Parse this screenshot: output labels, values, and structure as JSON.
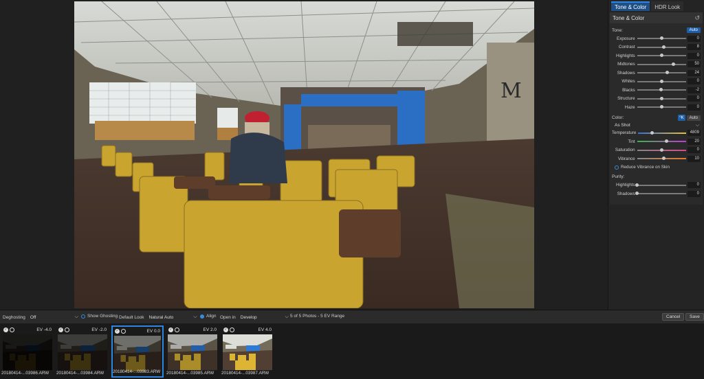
{
  "tabs": [
    {
      "label": "Tone & Color",
      "active": true
    },
    {
      "label": "HDR Look",
      "active": false
    }
  ],
  "panel": {
    "section_title": "Tone & Color",
    "tone_label": "Tone:",
    "tone_auto": "Auto",
    "tone_sliders": [
      {
        "label": "Exposure",
        "value": "0",
        "pos": 0.5
      },
      {
        "label": "Contrast",
        "value": "8",
        "pos": 0.54
      },
      {
        "label": "Highlights",
        "value": "0",
        "pos": 0.5
      },
      {
        "label": "Midtones",
        "value": "50",
        "pos": 0.75
      },
      {
        "label": "Shadows",
        "value": "24",
        "pos": 0.62
      },
      {
        "label": "Whites",
        "value": "0",
        "pos": 0.5
      },
      {
        "label": "Blacks",
        "value": "-2",
        "pos": 0.49
      },
      {
        "label": "Structure",
        "value": "0",
        "pos": 0.5
      },
      {
        "label": "Haze",
        "value": "0",
        "pos": 0.5
      }
    ],
    "color_label": "Color:",
    "color_auto": "Auto",
    "wb_preset": "As Shot",
    "color_sliders": [
      {
        "label": "Temperature",
        "value": "4809",
        "pos": 0.3,
        "grad": "linear-gradient(90deg,#3a6fd8,#e8c23a)"
      },
      {
        "label": "Tint",
        "value": "20",
        "pos": 0.6,
        "grad": "linear-gradient(90deg,#3cb44a,#c23ad8)"
      },
      {
        "label": "Saturation",
        "value": "0",
        "pos": 0.5,
        "grad": "linear-gradient(90deg,#888,#d84a8f)"
      },
      {
        "label": "Vibrance",
        "value": "10",
        "pos": 0.55,
        "grad": "linear-gradient(90deg,#888,#e07a2a)"
      }
    ],
    "reduce_vibrance": "Reduce Vibrance on Skin",
    "purity_label": "Purity:",
    "purity_sliders": [
      {
        "label": "Highlights",
        "value": "0",
        "pos": 0.0
      },
      {
        "label": "Shadows",
        "value": "0",
        "pos": 0.0
      }
    ]
  },
  "bottombar": {
    "deghosting_label": "Deghosting",
    "deghosting_value": "Off",
    "show_ghosting": "Show Ghosting",
    "default_look_label": "Default Look",
    "default_look_value": "Natural Auto",
    "align": "Align",
    "open_in_label": "Open in",
    "open_in_value": "Develop",
    "status": "5 of 5 Photos - 5 EV Range",
    "cancel": "Cancel",
    "save": "Save"
  },
  "filmstrip": [
    {
      "ev": "EV -4.0",
      "name": "20180414-...03986.ARW",
      "brightness": 0.12,
      "selected": false
    },
    {
      "ev": "EV -2.0",
      "name": "20180414-...03984.ARW",
      "brightness": 0.3,
      "selected": false
    },
    {
      "ev": "EV 0.0",
      "name": "20180414-...03983.ARW",
      "brightness": 0.55,
      "selected": true
    },
    {
      "ev": "EV 2.0",
      "name": "20180414-...03985.ARW",
      "brightness": 0.85,
      "selected": false
    },
    {
      "ev": "EV 4.0",
      "name": "20180414-...03987.ARW",
      "brightness": 1.1,
      "selected": false
    }
  ],
  "colors": {
    "accent": "#2e86de",
    "panel_bg": "#242424",
    "seat_yellow": "#c9a530",
    "curtain_blue": "#2a6fc4"
  }
}
